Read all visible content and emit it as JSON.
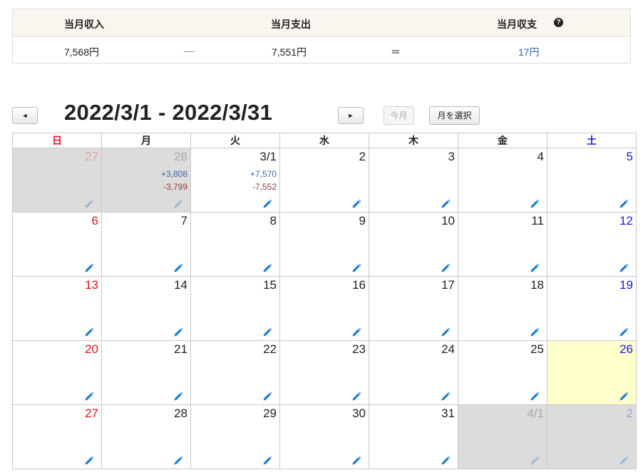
{
  "summary": {
    "income_label": "当月収入",
    "expense_label": "当月支出",
    "balance_label": "当月収支",
    "help_symbol": "?",
    "income_value": "7,568円",
    "minus_symbol": "―",
    "expense_value": "7,551円",
    "equals_symbol": "＝",
    "balance_value": "17円"
  },
  "nav": {
    "prev_label": "◄",
    "next_label": "►",
    "title": "2022/3/1 - 2022/3/31",
    "today_label": "今月",
    "select_month_label": "月を選択"
  },
  "calendar": {
    "weekdays": [
      "日",
      "月",
      "火",
      "水",
      "木",
      "金",
      "土"
    ],
    "weeks": [
      [
        {
          "day": "27",
          "other": true
        },
        {
          "day": "28",
          "other": true,
          "income": "+3,808",
          "expense": "-3,799"
        },
        {
          "day": "3/1",
          "income": "+7,570",
          "expense": "-7,552"
        },
        {
          "day": "2"
        },
        {
          "day": "3"
        },
        {
          "day": "4"
        },
        {
          "day": "5"
        }
      ],
      [
        {
          "day": "6"
        },
        {
          "day": "7"
        },
        {
          "day": "8"
        },
        {
          "day": "9"
        },
        {
          "day": "10"
        },
        {
          "day": "11"
        },
        {
          "day": "12"
        }
      ],
      [
        {
          "day": "13"
        },
        {
          "day": "14"
        },
        {
          "day": "15"
        },
        {
          "day": "16"
        },
        {
          "day": "17"
        },
        {
          "day": "18"
        },
        {
          "day": "19"
        }
      ],
      [
        {
          "day": "20"
        },
        {
          "day": "21"
        },
        {
          "day": "22"
        },
        {
          "day": "23"
        },
        {
          "day": "24"
        },
        {
          "day": "25"
        },
        {
          "day": "26",
          "today": true
        }
      ],
      [
        {
          "day": "27"
        },
        {
          "day": "28"
        },
        {
          "day": "29"
        },
        {
          "day": "30"
        },
        {
          "day": "31"
        },
        {
          "day": "4/1",
          "other": true
        },
        {
          "day": "2",
          "other": true
        }
      ]
    ],
    "colors": {
      "sunday": "#e0141e",
      "saturday": "#1a1adc",
      "income": "#3a6aa8",
      "expense": "#a23a3a",
      "today_bg": "#ffffcc",
      "other_month_bg": "#dcdcdc",
      "pencil": "#1e7fd1"
    },
    "edit_icon": "pencil-icon"
  }
}
